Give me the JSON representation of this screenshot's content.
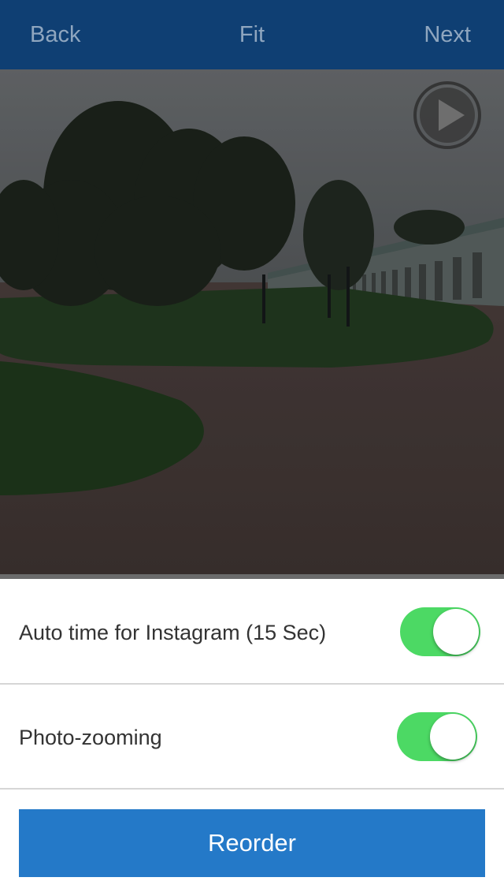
{
  "nav": {
    "back_label": "Back",
    "title_label": "Fit",
    "next_label": "Next",
    "background": "#0f3f73",
    "text_color": "#8fa6bf"
  },
  "preview": {
    "play_icon": "play-icon"
  },
  "settings": {
    "rows": [
      {
        "label": "Auto time for Instagram (15 Sec)",
        "enabled": true
      },
      {
        "label": "Photo-zooming",
        "enabled": true
      }
    ],
    "toggle_on_color": "#4cd964"
  },
  "reorder": {
    "label": "Reorder",
    "color": "#2479c8"
  }
}
